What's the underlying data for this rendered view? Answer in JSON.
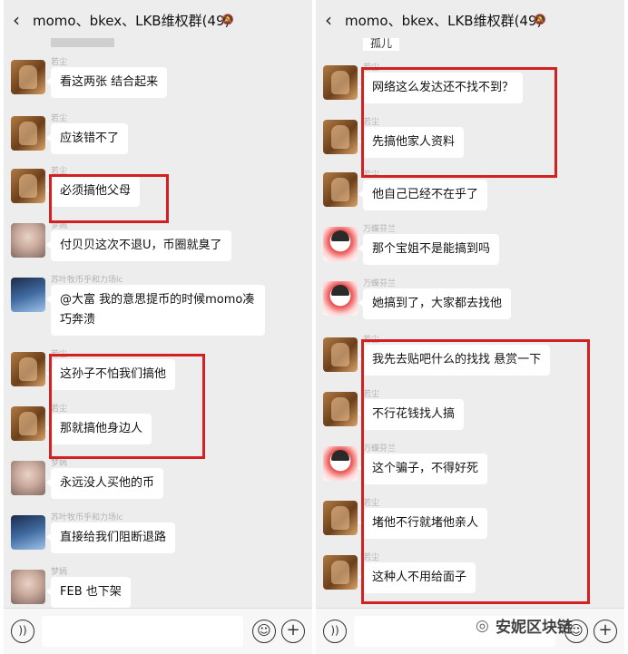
{
  "chat_title": "momo、bkex、LKB维权群(49)",
  "icons": {
    "back": "chevron-left-icon",
    "mute": "bell-mute-icon",
    "voice": "voice-icon",
    "emoji": "emoji-icon",
    "plus": "plus-icon",
    "watermark": "wechat-icon"
  },
  "colors": {
    "highlight_border": "#d32121",
    "chat_bg": "#ededed",
    "bubble_bg": "#ffffff"
  },
  "left_panel": {
    "messages": [
      {
        "sender": "若尘",
        "text": "看这两张 结合起来"
      },
      {
        "sender": "若尘",
        "text": "应该错不了"
      },
      {
        "sender": "若尘",
        "text": "必须搞他父母"
      },
      {
        "sender": "梦嫣",
        "text": "付贝贝这次不退U，币圈就臭了"
      },
      {
        "sender": "苏叶牧币乎和力场lc",
        "text": "@大富  我的意思提币的时候momo凑巧奔溃"
      },
      {
        "sender": "若尘",
        "text": "这孙子不怕我们搞他"
      },
      {
        "sender": "若尘",
        "text": "那就搞他身边人"
      },
      {
        "sender": "梦嫣",
        "text": "永远没人买他的币"
      },
      {
        "sender": "苏叶牧币乎和力场lc",
        "text": "直接给我们阻断退路"
      },
      {
        "sender": "梦嫣",
        "text": "FEB 也下架"
      }
    ]
  },
  "right_panel": {
    "top_stub": "孤儿",
    "messages": [
      {
        "sender": "若尘",
        "text": "网络这么发达还不找不到？"
      },
      {
        "sender": "若尘",
        "text": "先搞他家人资料"
      },
      {
        "sender": "若尘",
        "text": "他自己已经不在乎了"
      },
      {
        "sender": "万蝶芬兰",
        "text": "那个宝姐不是能搞到吗"
      },
      {
        "sender": "万蝶芬兰",
        "text": "她搞到了，大家都去找他"
      },
      {
        "sender": "若尘",
        "text": "我先去贴吧什么的找找    悬赏一下"
      },
      {
        "sender": "若尘",
        "text": "不行花钱找人搞"
      },
      {
        "sender": "万蝶芬兰",
        "text": "这个骗子，不得好死"
      },
      {
        "sender": "若尘",
        "text": "堵他不行就堵他亲人"
      },
      {
        "sender": "若尘",
        "text": "这种人不用给面子"
      }
    ]
  },
  "watermark": "安妮区块链"
}
